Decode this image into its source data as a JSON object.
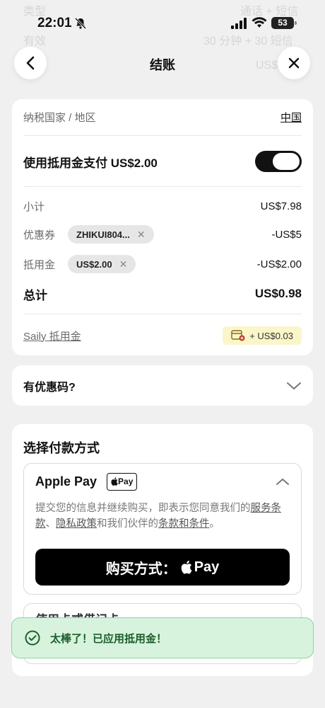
{
  "status_bar": {
    "time": "22:01",
    "battery": "53"
  },
  "background_ghost": {
    "line1_left": "类型",
    "line1_right": "通话 + 短信",
    "line2_left": "有效",
    "line2_right": "30 分钟 + 30 短信",
    "line3_right": "US$"
  },
  "header": {
    "title": "结账"
  },
  "summary": {
    "tax_country_label": "纳税国家 / 地区",
    "tax_country_value": "中国",
    "use_credit_label": "使用抵用金支付 US$2.00",
    "subtotal_label": "小计",
    "subtotal_value": "US$7.98",
    "coupon_label": "优惠券",
    "coupon_chip": "ZHIKUI804...",
    "coupon_value": "-US$5",
    "credit_label": "抵用金",
    "credit_chip": "US$2.00",
    "credit_value": "-US$2.00",
    "total_label": "总计",
    "total_value": "US$0.98",
    "saily_credit_link": "Saily 抵用金",
    "earn_badge": "+ US$0.03"
  },
  "promo": {
    "label": "有优惠码?"
  },
  "payment": {
    "title": "选择付款方式",
    "method_name": "Apple Pay",
    "method_mark": "Pay",
    "terms_prefix": "提交您的信息并继续购买，即表示您同意我们的",
    "terms_link1": "服务条款",
    "terms_sep": "、",
    "terms_link2": "隐私政策",
    "terms_mid": "和我们伙伴的",
    "terms_link3": "条款和条件",
    "terms_end": "。",
    "pay_button": "购买方式：",
    "pay_button_brand": "Pay",
    "second_method_partial": "使用卡或借记卡"
  },
  "toast": {
    "message": "太棒了！已应用抵用金！"
  }
}
